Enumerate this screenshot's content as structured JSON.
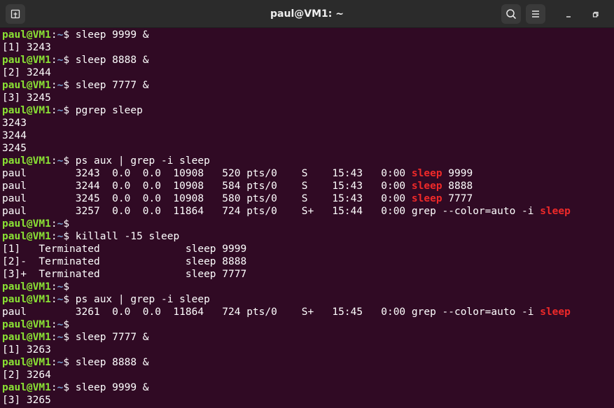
{
  "window": {
    "title": "paul@VM1: ~"
  },
  "icons": {
    "new_tab": "new-tab-icon",
    "search": "search-icon",
    "menu": "hamburger-menu-icon",
    "minimize": "minimize-icon",
    "restore": "restore-icon"
  },
  "colors": {
    "background": "#300a24",
    "user_host": "#8ae234",
    "path": "#729fcf",
    "match": "#ef2929",
    "text": "#ffffff"
  },
  "prompt": {
    "user_host": "paul@VM1",
    "colon": ":",
    "path": "~",
    "dollar": "$ "
  },
  "terminal_lines": [
    {
      "type": "prompt",
      "cmd": "sleep 9999 &"
    },
    {
      "type": "out",
      "text": "[1] 3243"
    },
    {
      "type": "prompt",
      "cmd": "sleep 8888 &"
    },
    {
      "type": "out",
      "text": "[2] 3244"
    },
    {
      "type": "prompt",
      "cmd": "sleep 7777 &"
    },
    {
      "type": "out",
      "text": "[3] 3245"
    },
    {
      "type": "prompt",
      "cmd": "pgrep sleep"
    },
    {
      "type": "out",
      "text": "3243"
    },
    {
      "type": "out",
      "text": "3244"
    },
    {
      "type": "out",
      "text": "3245"
    },
    {
      "type": "prompt",
      "cmd": "ps aux | grep -i sleep"
    },
    {
      "type": "match",
      "pre": "paul        3243  0.0  0.0  10908   520 pts/0    S    15:43   0:00 ",
      "hl": "sleep",
      "post": " 9999"
    },
    {
      "type": "match",
      "pre": "paul        3244  0.0  0.0  10908   584 pts/0    S    15:43   0:00 ",
      "hl": "sleep",
      "post": " 8888"
    },
    {
      "type": "match",
      "pre": "paul        3245  0.0  0.0  10908   580 pts/0    S    15:43   0:00 ",
      "hl": "sleep",
      "post": " 7777"
    },
    {
      "type": "match",
      "pre": "paul        3257  0.0  0.0  11864   724 pts/0    S+   15:44   0:00 grep --color=auto -i ",
      "hl": "sleep",
      "post": ""
    },
    {
      "type": "prompt",
      "cmd": ""
    },
    {
      "type": "prompt",
      "cmd": "killall -15 sleep"
    },
    {
      "type": "out",
      "text": "[1]   Terminated              sleep 9999"
    },
    {
      "type": "out",
      "text": "[2]-  Terminated              sleep 8888"
    },
    {
      "type": "out",
      "text": "[3]+  Terminated              sleep 7777"
    },
    {
      "type": "prompt",
      "cmd": ""
    },
    {
      "type": "prompt",
      "cmd": "ps aux | grep -i sleep"
    },
    {
      "type": "match",
      "pre": "paul        3261  0.0  0.0  11864   724 pts/0    S+   15:45   0:00 grep --color=auto -i ",
      "hl": "sleep",
      "post": ""
    },
    {
      "type": "prompt",
      "cmd": ""
    },
    {
      "type": "prompt",
      "cmd": "sleep 7777 &"
    },
    {
      "type": "out",
      "text": "[1] 3263"
    },
    {
      "type": "prompt",
      "cmd": "sleep 8888 &"
    },
    {
      "type": "out",
      "text": "[2] 3264"
    },
    {
      "type": "prompt",
      "cmd": "sleep 9999 &"
    },
    {
      "type": "out",
      "text": "[3] 3265"
    }
  ]
}
